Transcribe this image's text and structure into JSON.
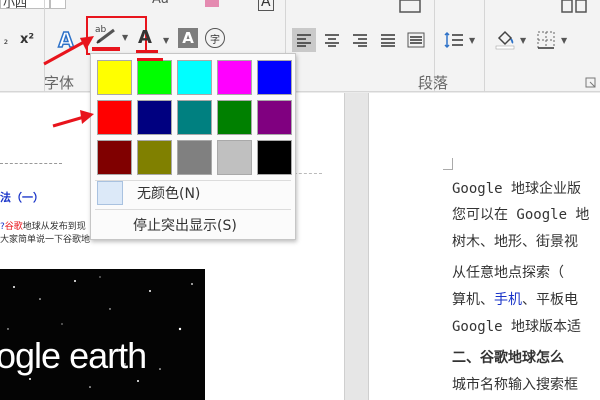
{
  "ribbon": {
    "top_fragments": {
      "font_box": "小四",
      "aa_label": "Aa",
      "a_label": "A"
    },
    "subscript_label": "₂",
    "superscript_label": "x²",
    "text_effects_label": "A",
    "highlight_label": "ab",
    "font_color_label": "A",
    "char_shading_label": "A",
    "enclose_char_label": "字",
    "groups": {
      "font": "字体",
      "paragraph": "段落"
    }
  },
  "palette": {
    "colors": [
      [
        "#ffff00",
        "#00ff00",
        "#00ffff",
        "#ff00ff",
        "#0000ff"
      ],
      [
        "#ff0000",
        "#000080",
        "#008080",
        "#008000",
        "#800080"
      ],
      [
        "#800000",
        "#808000",
        "#808080",
        "#c0c0c0",
        "#000000"
      ]
    ],
    "no_color_label": "无颜色(N)",
    "stop_highlight_label": "停止突出显示(S)"
  },
  "doc_left": {
    "heading": "法（一）",
    "snippet1_link": "谷歌",
    "snippet1_text": "地球从发布到现",
    "snippet2_text": "大家简单说一下谷歌地",
    "snippet_prefix": "?",
    "image_text": "ogle earth"
  },
  "doc_right": {
    "lines": [
      "Google 地球企业版",
      "您可以在 Google 地",
      "树木、地形、街景视",
      "  从任意地点探索（",
      "算机、",
      "、平板电",
      "Google 地球版本适",
      "  二、谷歌地球怎么",
      "城市名称输入搜索框"
    ],
    "link_word": "手机"
  },
  "colors": {
    "accent_red": "#e8141c",
    "ribbon_bg": "#f3f3f3"
  }
}
